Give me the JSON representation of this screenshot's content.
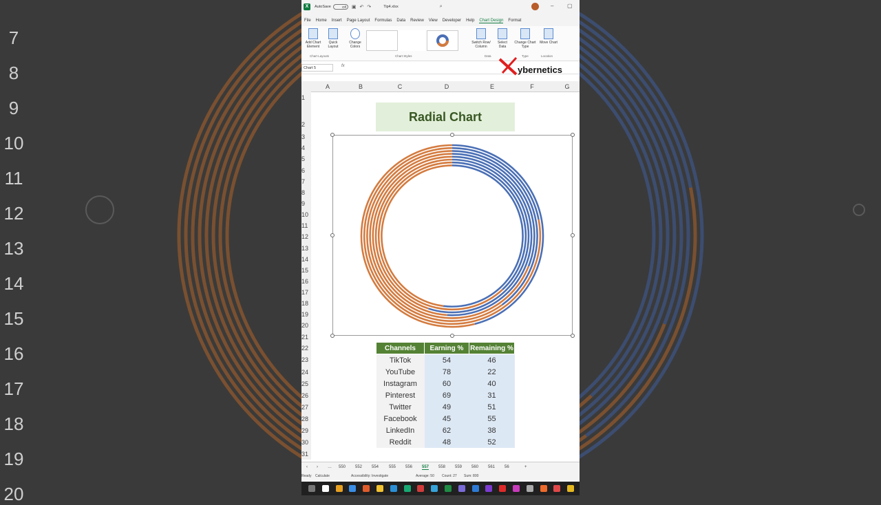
{
  "background": {
    "row_numbers": [
      "7",
      "8",
      "9",
      "10",
      "11",
      "12",
      "13",
      "14",
      "15",
      "16",
      "17",
      "18",
      "19",
      "20"
    ]
  },
  "titlebar": {
    "autosave_label": "AutoSave",
    "autosave_state": "Off",
    "filename": "Tip4.xlsx"
  },
  "menu": {
    "tabs": [
      "File",
      "Home",
      "Insert",
      "Page Layout",
      "Formulas",
      "Data",
      "Review",
      "View",
      "Developer",
      "Help",
      "Chart Design",
      "Format"
    ],
    "active": "Chart Design"
  },
  "ribbon": {
    "add_chart_element": "Add Chart Element",
    "quick_layout": "Quick Layout",
    "change_colors": "Change Colors",
    "switch_row_column": "Switch Row/ Column",
    "select_data": "Select Data",
    "change_chart_type": "Change Chart Type",
    "move_chart": "Move Chart",
    "group_chart_layouts": "Chart Layouts",
    "group_chart_styles": "Chart Styles",
    "group_data": "Data",
    "group_type": "Type",
    "group_location": "Location"
  },
  "formula_bar": {
    "name_box": "Chart 5",
    "fx": "fx"
  },
  "brand": {
    "logo_text": "ybernetics"
  },
  "sheet": {
    "columns": [
      "A",
      "B",
      "C",
      "D",
      "E",
      "F",
      "G"
    ],
    "rows": [
      "1",
      "2",
      "3",
      "4",
      "5",
      "6",
      "7",
      "8",
      "9",
      "10",
      "11",
      "12",
      "13",
      "14",
      "15",
      "16",
      "17",
      "18",
      "19",
      "20",
      "21",
      "22",
      "23",
      "24",
      "25",
      "26",
      "27",
      "28",
      "29",
      "30",
      "31"
    ],
    "title": "Radial Chart"
  },
  "table": {
    "headers": [
      "Channels",
      "Earning %",
      "Remaining %"
    ],
    "rows": [
      [
        "TikTok",
        "54",
        "46"
      ],
      [
        "YouTube",
        "78",
        "22"
      ],
      [
        "Instagram",
        "60",
        "40"
      ],
      [
        "Pinterest",
        "69",
        "31"
      ],
      [
        "Twitter",
        "49",
        "51"
      ],
      [
        "Facebook",
        "45",
        "55"
      ],
      [
        "LinkedIn",
        "62",
        "38"
      ],
      [
        "Reddit",
        "48",
        "52"
      ]
    ]
  },
  "chart_data": {
    "type": "radial",
    "categories": [
      "TikTok",
      "YouTube",
      "Instagram",
      "Pinterest",
      "Twitter",
      "Facebook",
      "LinkedIn",
      "Reddit"
    ],
    "series": [
      {
        "name": "Earning %",
        "values": [
          54,
          78,
          60,
          69,
          49,
          45,
          62,
          48
        ],
        "color": "#d47b3f"
      },
      {
        "name": "Remaining %",
        "values": [
          46,
          22,
          40,
          31,
          51,
          55,
          38,
          52
        ],
        "color": "#4a6fb5"
      }
    ]
  },
  "sheet_tabs": {
    "tabs": [
      "550",
      "552",
      "554",
      "555",
      "556",
      "557",
      "558",
      "559",
      "560",
      "561",
      "56"
    ],
    "active": "557"
  },
  "status": {
    "ready": "Ready",
    "calculate": "Calculate",
    "accessibility": "Accessibility: Investigate",
    "average": "Average: 50",
    "count": "Count: 27",
    "sum": "Sum: 800"
  }
}
